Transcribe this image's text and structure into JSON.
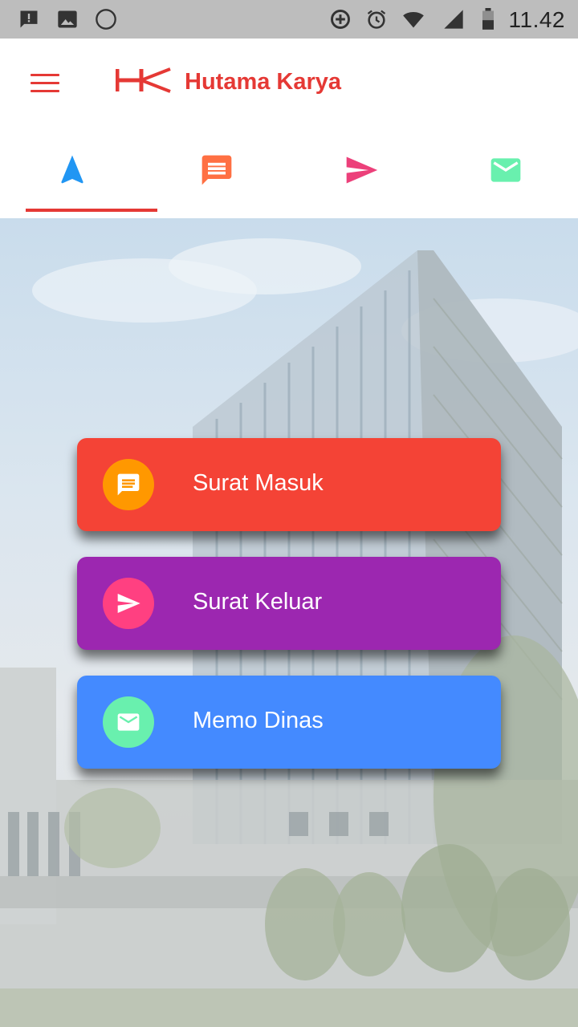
{
  "status_bar": {
    "time": "11.42",
    "left_icons": [
      "alert-chat-icon",
      "gallery-icon",
      "circle-icon"
    ],
    "right_icons": [
      "data-saver-icon",
      "alarm-icon",
      "wifi-icon",
      "signal-icon",
      "battery-icon"
    ]
  },
  "app_bar": {
    "brand": "Hutama Karya",
    "menu_icon": "hamburger-icon",
    "logo": "hk-logo",
    "brand_color": "#e53935"
  },
  "tabs": [
    {
      "icon": "navigation-icon",
      "color": "#2196f3",
      "selected": true
    },
    {
      "icon": "message-icon",
      "color": "#ff7043",
      "selected": false
    },
    {
      "icon": "send-icon",
      "color": "#ec407a",
      "selected": false
    },
    {
      "icon": "mail-icon",
      "color": "#69f0ae",
      "selected": false
    }
  ],
  "actions": [
    {
      "label": "Surat Masuk",
      "icon": "message-icon",
      "bg": "#f44336",
      "icon_bg": "#ff9800"
    },
    {
      "label": "Surat Keluar",
      "icon": "send-icon",
      "bg": "#9c27b0",
      "icon_bg": "#ff4081"
    },
    {
      "label": "Memo Dinas",
      "icon": "mail-icon",
      "bg": "#448aff",
      "icon_bg": "#69f0ae"
    }
  ]
}
